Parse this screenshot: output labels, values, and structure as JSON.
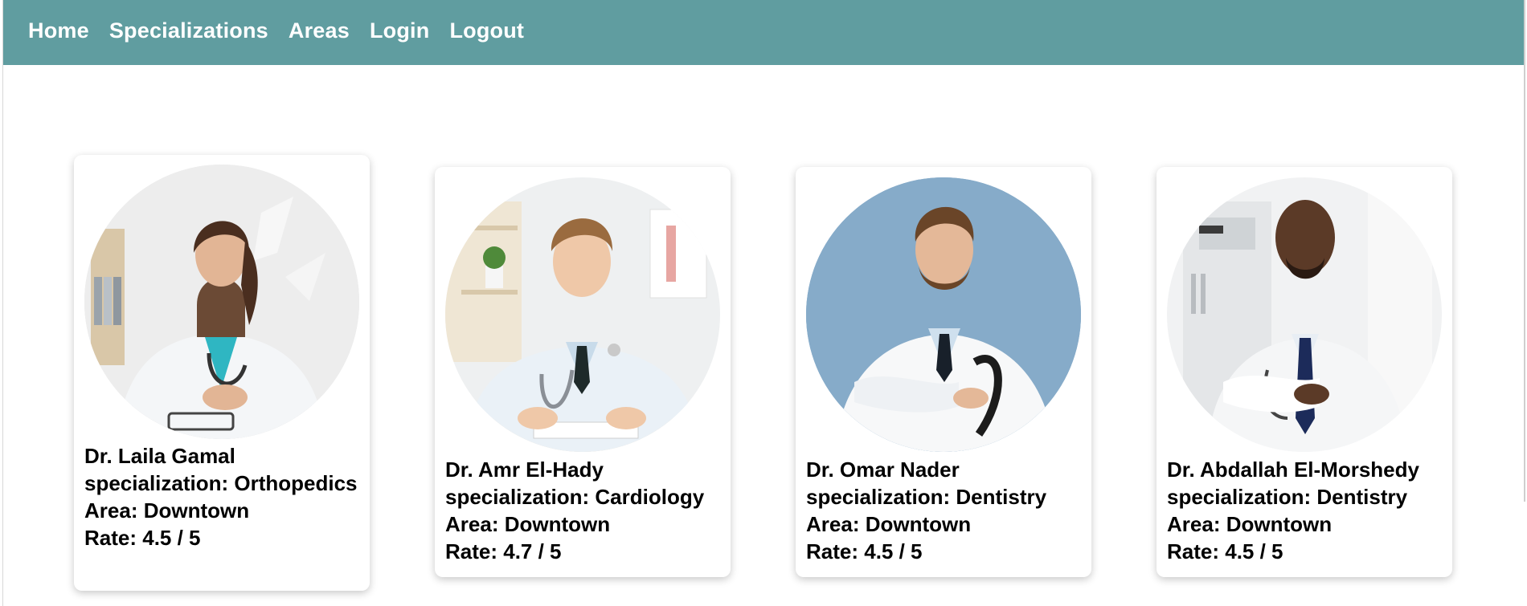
{
  "navbar": {
    "background": "#609da0",
    "links": [
      "Home",
      "Specializations",
      "Areas",
      "Login",
      "Logout"
    ]
  },
  "doctors": [
    {
      "name": "Dr. Laila Gamal",
      "specialization_line": "specialization: Orthopedics",
      "area_line": "Area: Downtown",
      "rate_line": "Rate: 4.5 / 5",
      "photo": "female-doctor-photo"
    },
    {
      "name": "Dr. Amr El-Hady",
      "specialization_line": "specialization: Cardiology",
      "area_line": "Area: Downtown",
      "rate_line": "Rate: 4.7 / 5",
      "photo": "male-doctor-desk-photo"
    },
    {
      "name": "Dr. Omar Nader",
      "specialization_line": "specialization: Dentistry",
      "area_line": "Area: Downtown",
      "rate_line": "Rate: 4.5 / 5",
      "photo": "male-doctor-blue-background-photo"
    },
    {
      "name": "Dr. Abdallah El-Morshedy",
      "specialization_line": "specialization: Dentistry",
      "area_line": "Area: Downtown",
      "rate_line": "Rate: 4.5 / 5",
      "photo": "male-doctor-clinic-photo"
    }
  ]
}
